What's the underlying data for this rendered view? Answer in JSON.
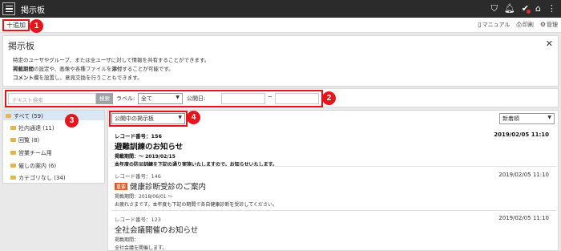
{
  "app": {
    "title": "掲示板"
  },
  "toolbar": {
    "add_label": "十追加",
    "manual_label": "マニュアル",
    "print_label": "印刷",
    "admin_label": "管理"
  },
  "badges": [
    "1",
    "2",
    "3",
    "4"
  ],
  "description": {
    "title": "掲示板",
    "line1": "特定のユーザやグループ、または全ユーザに対して情報を共有することができます。",
    "line2_bold1": "掲載期間",
    "line2_mid": "の設定や、画像や各種ファイルを",
    "line2_bold2": "添付",
    "line2_end": "することが可能です。",
    "line3_bold": "コメント",
    "line3_end": "欄を設置し、意見交換を行うこともできます。"
  },
  "filter": {
    "search_placeholder": "テキスト検索",
    "search_button": "検索",
    "label_label": "ラベル:",
    "label_value": "全て",
    "date_label": "公開日:",
    "date_separator": "~"
  },
  "categories": [
    {
      "label": "すべて (59)"
    },
    {
      "label": "社内通達 (11)"
    },
    {
      "label": "回覧 (8)"
    },
    {
      "label": "営業チーム用"
    },
    {
      "label": "催しの案内 (6)"
    },
    {
      "label": "カテゴリなし (34)"
    }
  ],
  "list": {
    "status_value": "公開中の掲示板",
    "sort_value": "新着順"
  },
  "records": [
    {
      "number": "レコード番号：156",
      "date": "2019/02/05 11:10",
      "title": "避難訓練のお知らせ",
      "tag": "",
      "period": "掲載期間：～ 2019/02/15",
      "body": "本年度の防災訓練を下記の通り実施いたしますので、お知らせいたします。"
    },
    {
      "number": "レコード番号：146",
      "date": "2019/02/05 11:10",
      "title": "健康診断受診のご案内",
      "tag": "重要",
      "period": "掲載期間：2018/06/01 ～",
      "body": "お疲れさまです。本年度も下記の期間で各自健康診断を受診してください。"
    },
    {
      "number": "レコード番号：123",
      "date": "2019/02/05 11:10",
      "title": "全社会議開催のお知らせ",
      "tag": "",
      "period": "掲載期間：",
      "body": "全社会議を開催します。"
    }
  ]
}
